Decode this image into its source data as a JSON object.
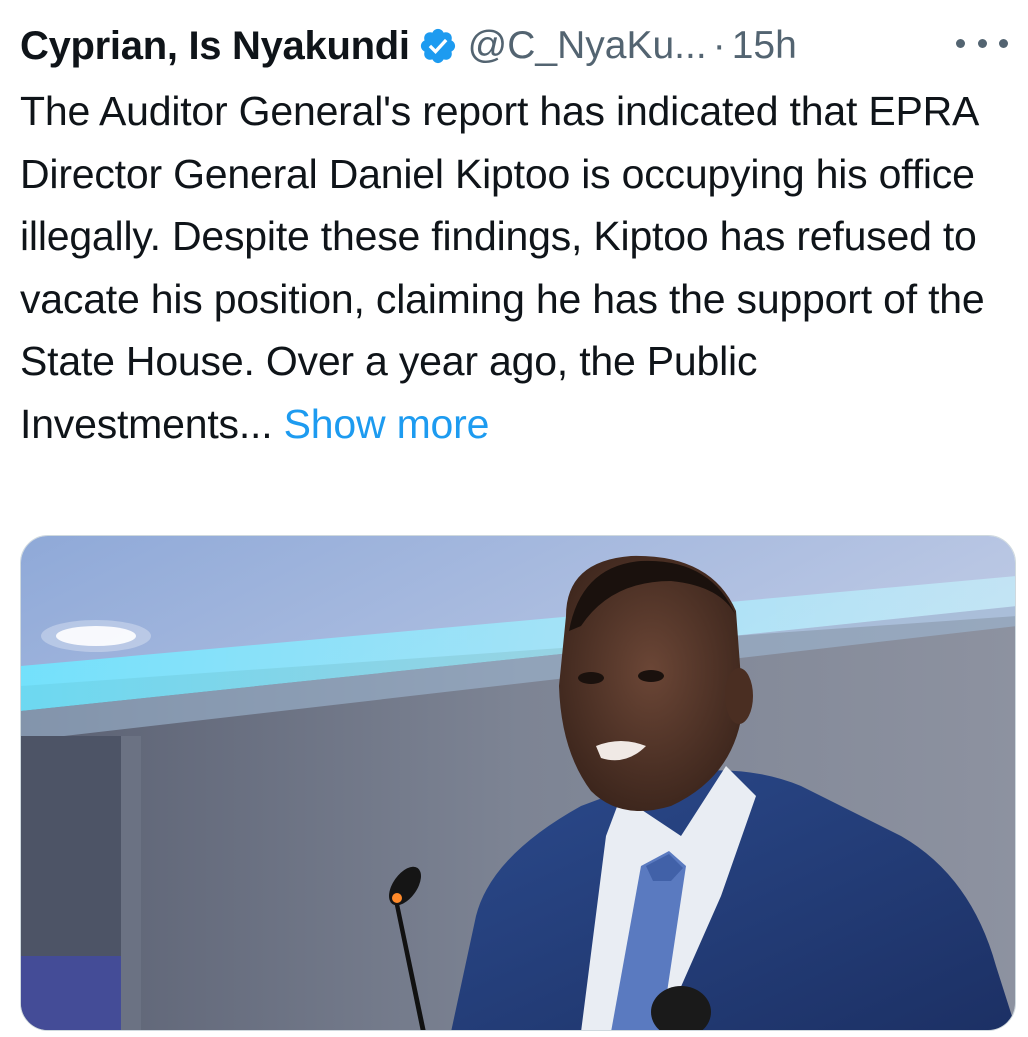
{
  "tweet": {
    "author": {
      "display_name": "Cyprian, Is Nyakundi",
      "handle": "@C_NyaKu...",
      "verified_icon": "verified-badge-icon"
    },
    "separator": "·",
    "timestamp": "15h",
    "more_icon": "more-options-icon",
    "text": "The Auditor General's report has indicated that EPRA Director General Daniel Kiptoo is occupying his office illegally. Despite these findings, Kiptoo has refused to vacate his position, claiming he has the support of the State House. Over a year ago, the Public Investments...",
    "show_more_label": "Show more",
    "media": {
      "kind": "photo"
    }
  },
  "colors": {
    "text_primary": "#0f1419",
    "text_secondary": "#536471",
    "link": "#1d9bf0",
    "verified": "#1d9bf0"
  }
}
